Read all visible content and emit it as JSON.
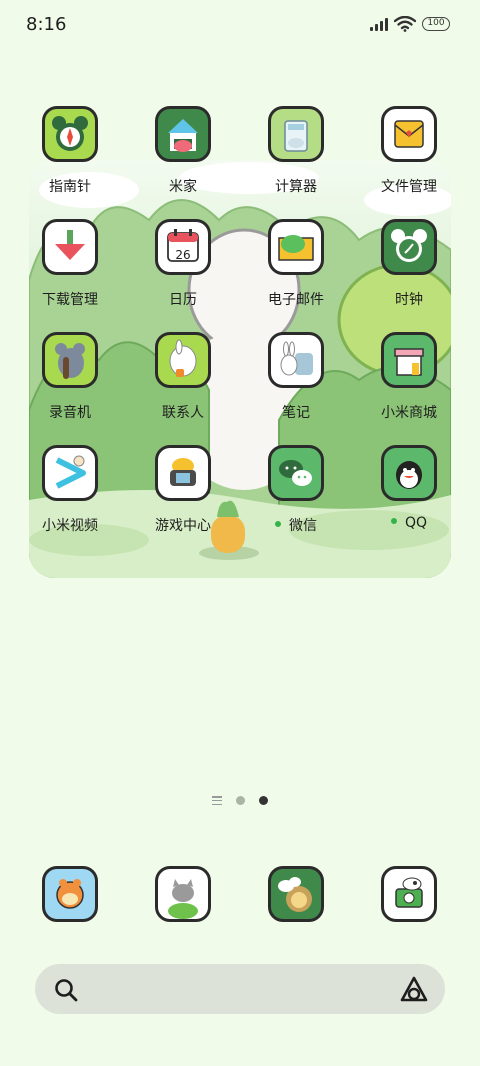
{
  "status_bar": {
    "time": "8:16",
    "battery": "100"
  },
  "apps": [
    {
      "id": "compass",
      "label": "指南针",
      "icon": "compass-icon"
    },
    {
      "id": "mi-home",
      "label": "米家",
      "icon": "mi-home-icon"
    },
    {
      "id": "calculator",
      "label": "计算器",
      "icon": "calculator-icon"
    },
    {
      "id": "file-manager",
      "label": "文件管理",
      "icon": "folder-icon"
    },
    {
      "id": "downloads",
      "label": "下载管理",
      "icon": "download-icon"
    },
    {
      "id": "calendar",
      "label": "日历",
      "icon": "calendar-icon",
      "day": "26"
    },
    {
      "id": "email",
      "label": "电子邮件",
      "icon": "email-icon"
    },
    {
      "id": "clock",
      "label": "时钟",
      "icon": "clock-icon"
    },
    {
      "id": "recorder",
      "label": "录音机",
      "icon": "recorder-icon"
    },
    {
      "id": "contacts",
      "label": "联系人",
      "icon": "contacts-icon"
    },
    {
      "id": "notes",
      "label": "笔记",
      "icon": "notes-icon"
    },
    {
      "id": "mi-store",
      "label": "小米商城",
      "icon": "store-icon"
    },
    {
      "id": "mi-video",
      "label": "小米视频",
      "icon": "video-icon"
    },
    {
      "id": "game-center",
      "label": "游戏中心",
      "icon": "game-icon"
    },
    {
      "id": "wechat",
      "label": "微信",
      "icon": "wechat-icon",
      "notification": true
    },
    {
      "id": "qq",
      "label": "QQ",
      "icon": "qq-icon",
      "notification": true
    }
  ],
  "dock": [
    {
      "id": "dock-1",
      "icon": "fox-app-icon"
    },
    {
      "id": "dock-2",
      "icon": "cat-app-icon"
    },
    {
      "id": "dock-3",
      "icon": "lion-app-icon"
    },
    {
      "id": "dock-4",
      "icon": "camera-cow-icon"
    }
  ],
  "search": {
    "icon": "search-icon",
    "assistant_icon": "assistant-icon"
  },
  "colors": {
    "background": "#f1fbe9",
    "icon_green": "#a8d94e",
    "dark_green": "#3f8a4b",
    "notification_dot": "#35b34a",
    "search_bar": "#dde2d9"
  }
}
